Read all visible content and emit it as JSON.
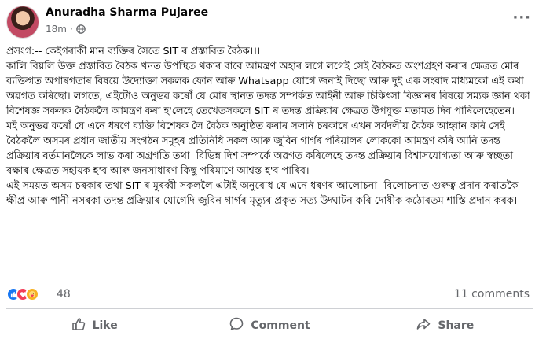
{
  "post": {
    "author": "Anuradha Sharma Pujaree",
    "timestamp": "18m",
    "separator": "·",
    "more": "···",
    "paragraphs": [
      "প্ৰসংগ:-- কেইগৰাকী মান ব্যক্তিৰ সৈতে SIT ৰ প্ৰস্তাবিত বৈঠক।।।",
      "কালি বিয়লি উক্ত প্ৰস্তাবিত বৈঠক খনত উপস্থিত থকাৰ বাবে আমন্ত্ৰণ অহাৰ লগে লগেই সেই বৈঠকত অংশগ্ৰহণ কৰাৰ ক্ষেত্ৰত মোৰ ব্যক্তিগত অপাৰগতাৰ বিষয়ে উদ্যোক্তা সকলক ফোন আৰু Whatsapp যোগে জনাই দিছো আৰু দুই এক সংবাদ মাধ্যমকো এই কথা অৱগত কৰিছো। লগতে, এইটোও অনুভৱ কৰোঁ যে মোৰ স্থানত তদন্ত সম্পৰ্কত আইনী আৰু চিকিৎসা বিজ্ঞানৰ বিষয়ে সম্যক জ্ঞান থকা বিশেষজ্ঞ সকলক বৈঠকলৈ আমন্ত্ৰণ কৰা হ'লেহে তেখেতসকলে SIT ৰ তদন্ত প্ৰক্ৰিয়াৰ ক্ষেত্ৰত উপযুক্ত মতামত দিব পাৰিলেহেতেন।",
      "মই অনুভৱ কৰোঁ যে এনে ধৰণে ব্যক্তি বিশেষক লৈ বৈঠক অনুষ্ঠিত কৰাৰ সলনি চৰকাৰে এখন সৰ্বদলীয় বৈঠক আহ্বান কৰি সেই বৈঠকলৈ অসমৰ প্ৰধান জাতীয় সংগঠন সমূহৰ প্ৰতিনিধি সকল আৰু জুবিন গাৰ্গৰ পৰিয়ালৰ লোককো আমন্ত্ৰণ কৰি আনি তদন্ত প্ৰক্ৰিয়াৰ বৰ্তমানলৈকে লাভ কৰা অগ্ৰগতি তথা  বিভিন্ন দিশ সম্পৰ্কে অৱগত কৰিলেহে তদন্ত প্ৰক্ৰিয়াৰ বিশ্বাসযোগ্যতা আৰু স্বচ্ছতা ৰক্ষাৰ ক্ষেত্ৰত সহায়ক হ'ব আৰু জনসাধাৰণ কিছু পৰিমাণে আশ্বস্ত হ'ব পাৰিব।",
      "এই সময়ত অসম চৰকাৰ তথা SIT ৰ মুৰব্বী সকললৈ এটাই অনুৰোধ যে এনে ধৰণৰ আলোচনা- বিলোচনাত গুৰুত্ব প্ৰদান কৰাতকৈ ক্ষীপ্ৰ আৰু পানী নসৰকা তদন্ত প্ৰক্ৰিয়াৰ যোগেদি জুবিন গাৰ্গৰ মৃত্যুৰ প্ৰকৃত সত্য উদ্ঘাটন কৰি দোষীক কঠোৰতম শাস্তি প্ৰদান কৰক।"
    ]
  },
  "reactions": {
    "types": [
      "like-icon",
      "love-icon",
      "care-icon"
    ],
    "count": "48",
    "comments": "11 comments"
  },
  "actions": {
    "like": "Like",
    "comment": "Comment",
    "share": "Share"
  },
  "colors": {
    "like": "#1877f2",
    "love": "#f33e58",
    "care": "#f7b125",
    "secondary_text": "#65676b"
  }
}
